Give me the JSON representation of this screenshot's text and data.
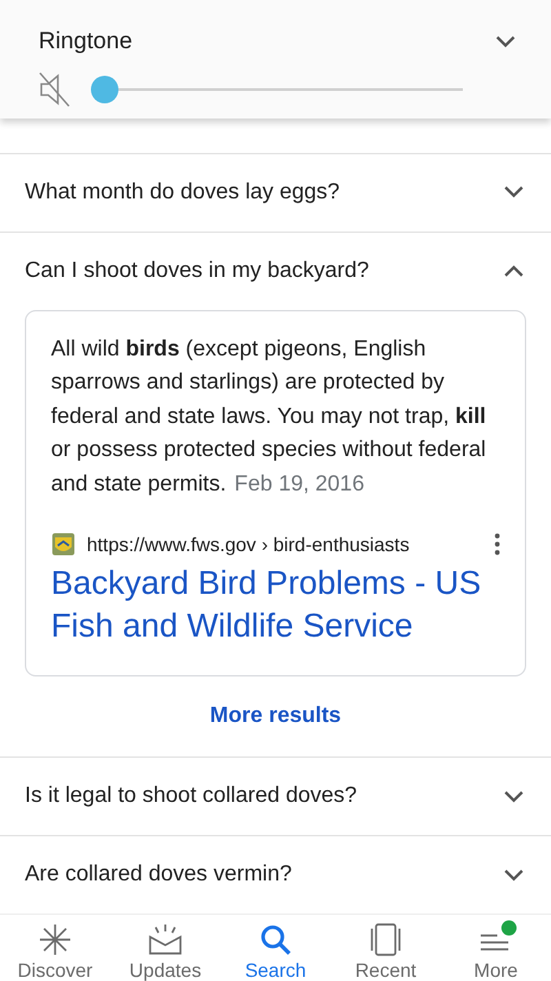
{
  "volume_panel": {
    "title": "Ringtone",
    "muted": true,
    "level": 0,
    "expanded": false
  },
  "questions": [
    {
      "question": "What month do doves lay eggs?",
      "expanded": false
    },
    {
      "question": "Can I shoot doves in my backyard?",
      "expanded": true,
      "answer": {
        "snippet": "All wild **birds** (except pigeons, English sparrows and starlings) are protected by federal and state laws. You may not trap, **kill** or possess protected species without federal and state permits.",
        "date": "Feb 19, 2016",
        "url": "https://www.fws.gov › bird-enthusiasts",
        "title": "Backyard Bird Problems - US Fish and Wildlife Service"
      },
      "more_results": "More results"
    },
    {
      "question": "Is it legal to shoot collared doves?",
      "expanded": false
    },
    {
      "question": "Are collared doves vermin?",
      "expanded": false
    }
  ],
  "bottom_nav": [
    {
      "label": "Discover",
      "kind": "discover",
      "selected": false,
      "notification": false
    },
    {
      "label": "Updates",
      "kind": "updates",
      "selected": false,
      "notification": false
    },
    {
      "label": "Search",
      "kind": "search",
      "selected": true,
      "notification": false
    },
    {
      "label": "Recent",
      "kind": "recent",
      "selected": false,
      "notification": false
    },
    {
      "label": "More",
      "kind": "more",
      "selected": false,
      "notification": true
    }
  ]
}
